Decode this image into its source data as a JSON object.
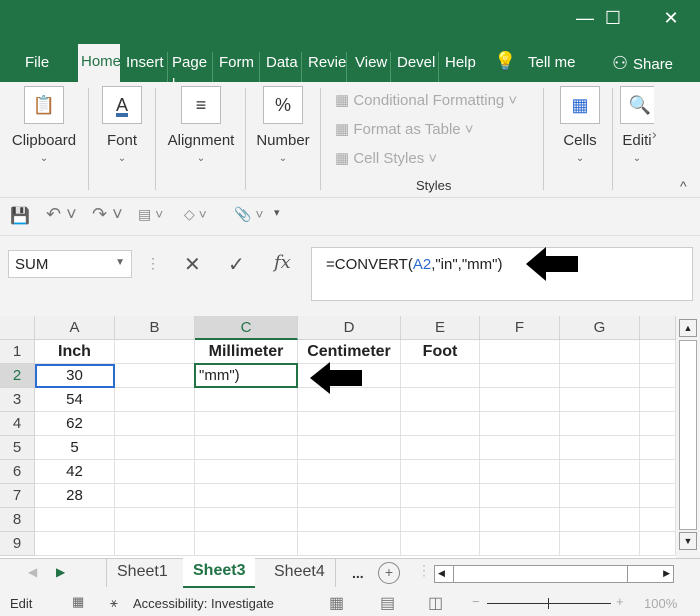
{
  "window": {
    "controls": [
      "—",
      "☐",
      "✕"
    ]
  },
  "tabs": [
    "File",
    "Home",
    "Insert",
    "Page l",
    "Form",
    "Data",
    "Revie",
    "View",
    "Devel",
    "Help"
  ],
  "tell_me": "Tell me",
  "share": "Share",
  "ribbon": {
    "groups": [
      "Clipboard",
      "Font",
      "Alignment",
      "Number"
    ],
    "styles": {
      "items": [
        "Conditional Formatting",
        "Format as Table",
        "Cell Styles"
      ],
      "label": "Styles"
    },
    "cells": "Cells",
    "editing": "Editi"
  },
  "name_box": "SUM",
  "formula": {
    "prefix": "=CONVERT(",
    "ref": "A2",
    "suffix": ",\"in\",\"mm\")"
  },
  "columns": [
    "A",
    "B",
    "C",
    "D",
    "E",
    "F",
    "G"
  ],
  "rows": [
    "1",
    "2",
    "3",
    "4",
    "5",
    "6",
    "7",
    "8",
    "9"
  ],
  "cells": {
    "A1": "Inch",
    "C1": "Millimeter",
    "D1": "Centimeter",
    "E1": "Foot",
    "A2": "30",
    "A3": "54",
    "A4": "62",
    "A5": "5",
    "A6": "42",
    "A7": "28",
    "C2": "\"mm\")"
  },
  "sheets": [
    "Sheet1",
    "Sheet3",
    "Sheet4"
  ],
  "active_sheet": "Sheet3",
  "more": "...",
  "status": {
    "mode": "Edit",
    "accessibility": "Accessibility: Investigate",
    "zoom": "100%"
  },
  "colors": {
    "accent": "#217346",
    "selection": "#217346"
  }
}
